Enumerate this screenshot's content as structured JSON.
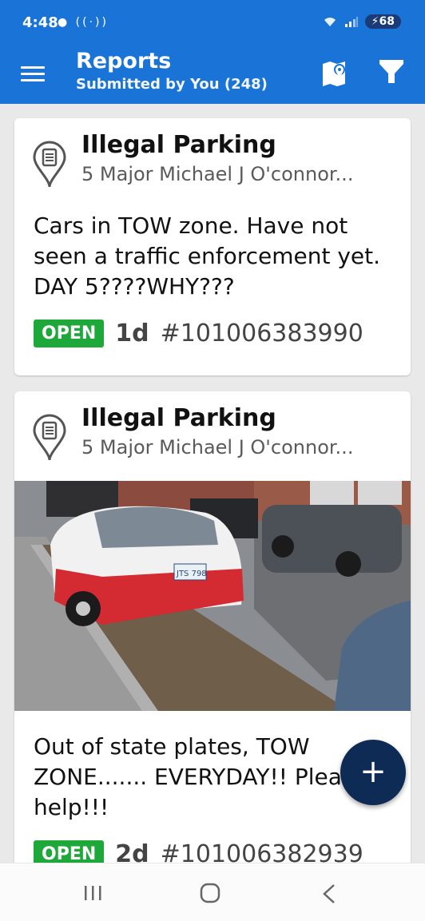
{
  "status_bar": {
    "time": "4:48",
    "battery": "68"
  },
  "header": {
    "title": "Reports",
    "subtitle": "Submitted by You (248)"
  },
  "reports": [
    {
      "category": "Illegal Parking",
      "address": "5 Major Michael J O'connor...",
      "description": "Cars in TOW zone. Have not seen a traffic enforcement yet. DAY 5????WHY???",
      "status": "OPEN",
      "age": "1d",
      "id": "#101006383990"
    },
    {
      "category": "Illegal Parking",
      "address": "5 Major Michael J O'connor...",
      "description": "Out of state plates, TOW ZONE....... EVERYDAY!! Please help!!!",
      "status": "OPEN",
      "age": "2d",
      "id": "#101006382939",
      "photo_plate": "JTS 798"
    }
  ],
  "fab": {
    "label": "+"
  },
  "colors": {
    "app_bar": "#1a73d6",
    "status_open": "#1fa83a",
    "fab": "#0e2b55"
  },
  "icons": {
    "menu": "hamburger-menu-icon",
    "map": "map-pin-icon",
    "filter": "filter-funnel-icon",
    "report": "report-pin-icon"
  }
}
